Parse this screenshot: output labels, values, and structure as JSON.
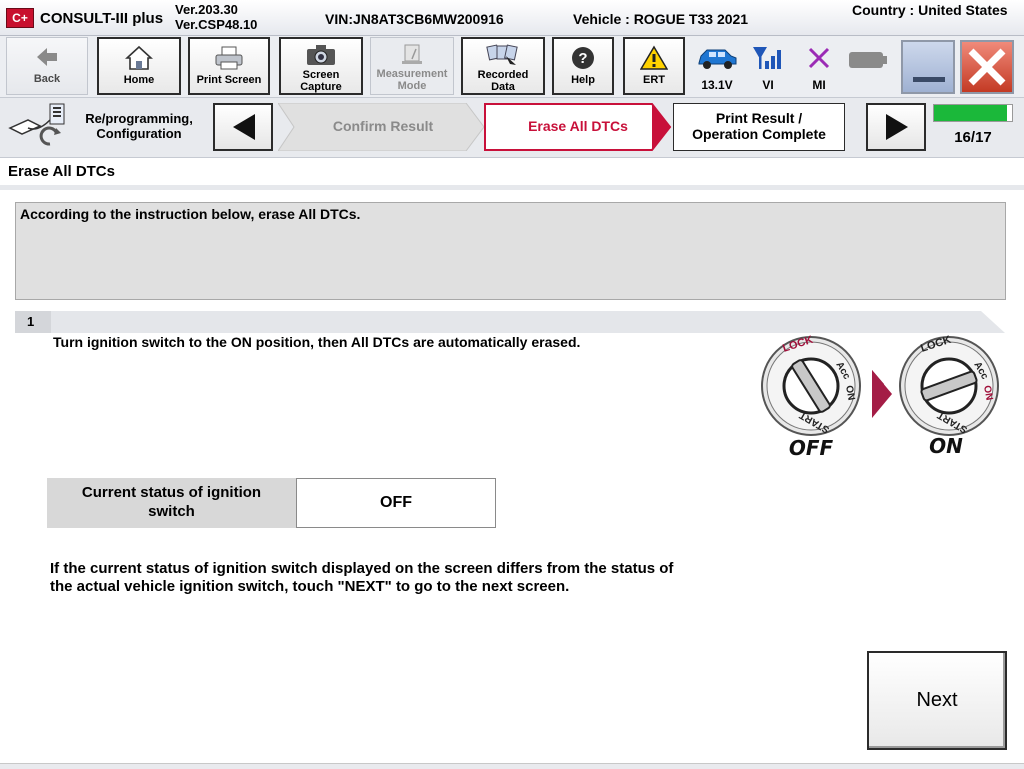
{
  "titlebar": {
    "logo": "C+",
    "app_name": "CONSULT-III plus",
    "version_line1": "Ver.203.30",
    "version_line2": "Ver.CSP48.10",
    "vin": "VIN:JN8AT3CB6MW200916",
    "vehicle": "Vehicle : ROGUE T33 2021",
    "country": "Country : United States"
  },
  "toolbar": {
    "back": "Back",
    "home": "Home",
    "print_screen": "Print Screen",
    "screen_capture_1": "Screen",
    "screen_capture_2": "Capture",
    "measurement_mode_1": "Measurement",
    "measurement_mode_2": "Mode",
    "recorded_data_1": "Recorded",
    "recorded_data_2": "Data",
    "help": "Help",
    "ert": "ERT",
    "battery_voltage": "13.1V",
    "vi": "VI",
    "mi": "MI"
  },
  "stepbar": {
    "section_label_1": "Re/programming,",
    "section_label_2": "Configuration",
    "prev_step": "Confirm Result",
    "current_step": "Erase All DTCs",
    "next_step_1": "Print Result /",
    "next_step_2": "Operation Complete",
    "progress_label": "16/17",
    "progress_fraction": 0.94
  },
  "content": {
    "section_title": "Erase All DTCs",
    "instruction": "According to the instruction below, erase All DTCs.",
    "step_number": "1",
    "step_text": "Turn ignition switch to the ON position, then All DTCs are automatically erased.",
    "ignition_from": "OFF",
    "ignition_to": "ON",
    "lock_label": "LOCK",
    "acc_label": "Acc",
    "on_label": "ON",
    "start_label": "START",
    "status_label_1": "Current status of ignition",
    "status_label_2": "switch",
    "status_value": "OFF",
    "note_line1": "If the current status of ignition switch displayed on the screen differs from the status of",
    "note_line2": "the actual vehicle ignition switch, touch \"NEXT\" to go to the next screen.",
    "next_button": "Next"
  },
  "colors": {
    "accent_red": "#c8103a",
    "progress_green": "#1bb83a",
    "panel_gray": "#e0e0e0"
  }
}
